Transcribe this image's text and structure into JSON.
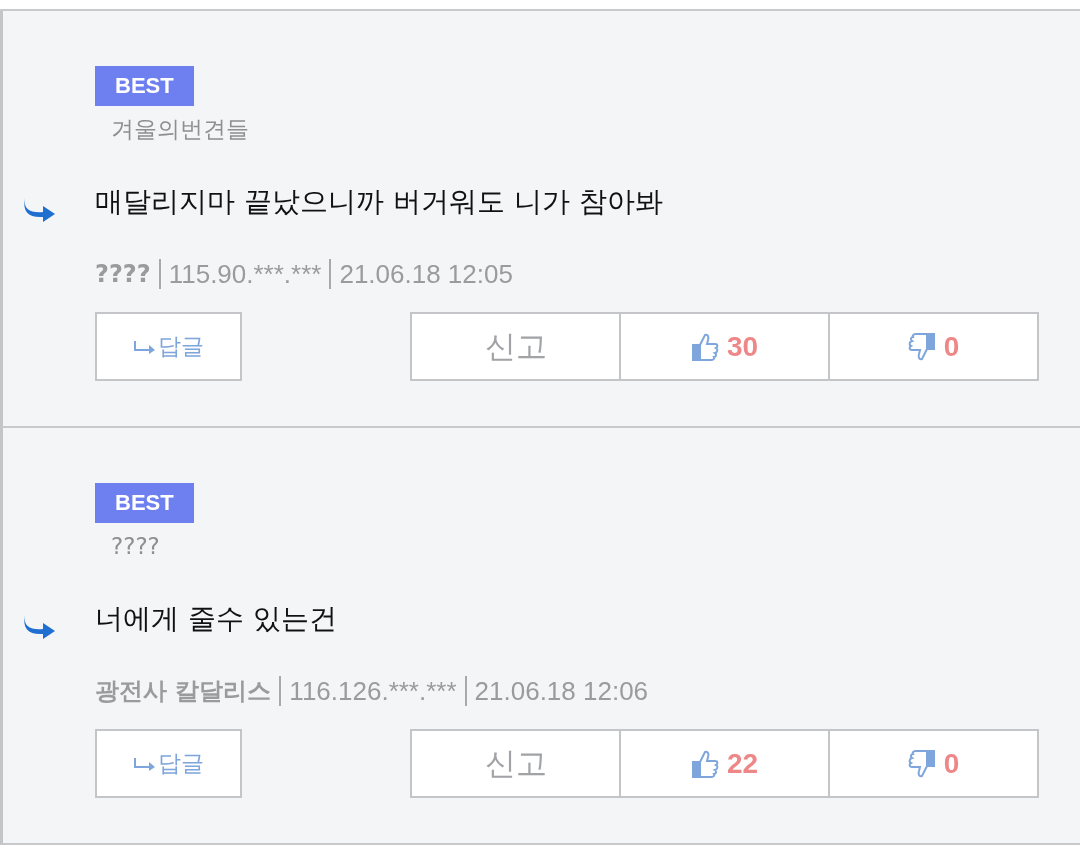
{
  "comments": [
    {
      "badge": "BEST",
      "nickname": "겨울의번견들",
      "text": "매달리지마 끝났으니까 버거워도 니가 참아봐",
      "author": "????",
      "ip": "115.90.***.***",
      "datetime": "21.06.18 12:05",
      "reply_label": "답글",
      "report_label": "신고",
      "likes": "30",
      "dislikes": "0"
    },
    {
      "badge": "BEST",
      "nickname": "????",
      "text": "너에게 줄수 있는건",
      "author": "광전사 칼달리스",
      "ip": "116.126.***.***",
      "datetime": "21.06.18 12:06",
      "reply_label": "답글",
      "report_label": "신고",
      "likes": "22",
      "dislikes": "0"
    }
  ]
}
